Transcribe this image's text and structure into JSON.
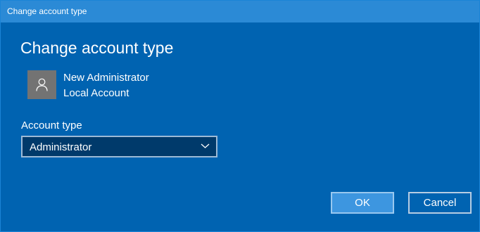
{
  "window": {
    "title": "Change account type"
  },
  "dialog": {
    "heading": "Change account type",
    "account": {
      "name": "New Administrator",
      "kind": "Local Account",
      "avatar_icon": "user-icon"
    },
    "account_type": {
      "label": "Account type",
      "selected": "Administrator"
    },
    "buttons": {
      "ok": "OK",
      "cancel": "Cancel"
    }
  },
  "colors": {
    "background": "#0063b1",
    "titlebar": "#2b8ad6",
    "select_background": "#003a6b",
    "ok_button": "#3d96e0",
    "avatar": "#737373"
  }
}
